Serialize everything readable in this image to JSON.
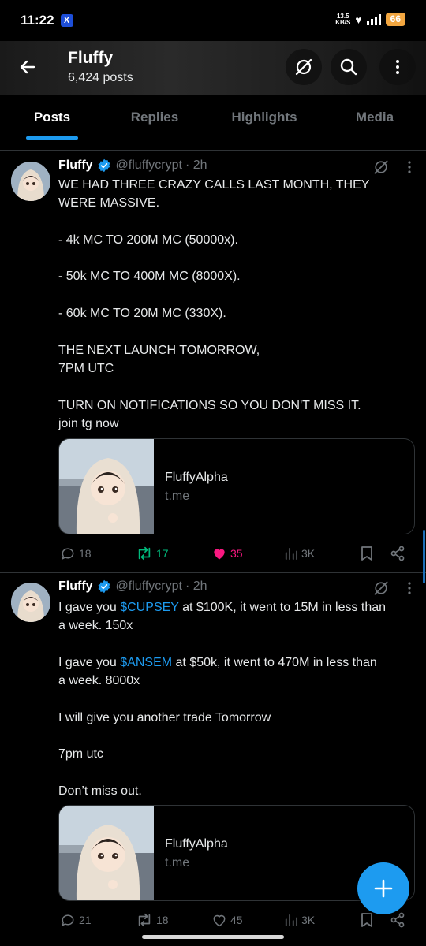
{
  "status_bar": {
    "time": "11:22",
    "app_badge": "X",
    "net_speed_value": "13.5",
    "net_speed_unit": "KB/S",
    "battery": "66"
  },
  "header": {
    "name": "Fluffy",
    "post_count": "6,424 posts"
  },
  "tabs": [
    {
      "label": "Posts",
      "active": true
    },
    {
      "label": "Replies",
      "active": false
    },
    {
      "label": "Highlights",
      "active": false
    },
    {
      "label": "Media",
      "active": false
    }
  ],
  "tweets": [
    {
      "name": "Fluffy",
      "handle": "@fluffycrypt",
      "time": "· 2h",
      "lines": [
        "WE HAD THREE CRAZY CALLS LAST MONTH, THEY",
        "WERE MASSIVE.",
        "",
        "- 4k MC TO 200M MC (50000x).",
        "",
        "- 50k MC TO 400M MC (8000X).",
        "",
        "- 60k MC TO 20M MC (330X).",
        "",
        "THE NEXT LAUNCH TOMORROW,",
        "7PM UTC",
        "",
        "TURN ON NOTIFICATIONS SO YOU DON'T MISS IT.",
        "join tg now"
      ],
      "card": {
        "title": "FluffyAlpha",
        "domain": "t.me"
      },
      "stats": {
        "replies": "18",
        "reposts": "17",
        "likes": "35",
        "views": "3K"
      }
    },
    {
      "name": "Fluffy",
      "handle": "@fluffycrypt",
      "time": "· 2h",
      "line1_pre": "I gave you ",
      "line1_tag": "$CUPSEY",
      "line1_post": " at $100K, it went to 15M in less than",
      "line2": "a week. 150x",
      "line3_pre": "I gave you ",
      "line3_tag": "$ANSEM",
      "line3_post": " at $50k, it went to 470M in less than",
      "line4": "a week. 8000x",
      "line5": "I will give you another trade Tomorrow",
      "line6": "7pm utc",
      "line7": "Don’t miss out.",
      "card": {
        "title": "FluffyAlpha",
        "domain": "t.me"
      },
      "stats": {
        "replies": "21",
        "reposts": "18",
        "likes": "45",
        "views": "3K"
      }
    }
  ],
  "colors": {
    "accent": "#1d9bf0",
    "repost_active": "#00ba7c",
    "like_active": "#f91880",
    "muted": "#71767b",
    "battery": "#f2a640"
  }
}
